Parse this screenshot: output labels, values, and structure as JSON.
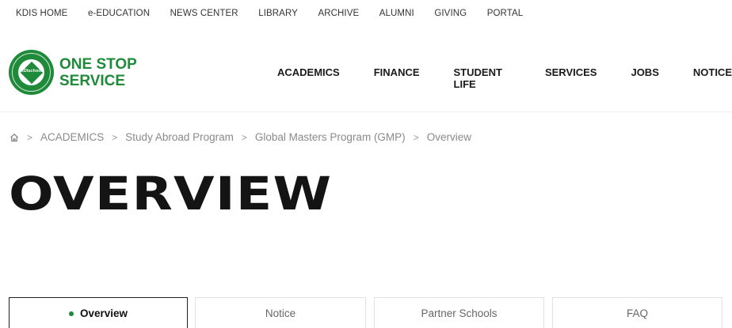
{
  "top_links": [
    "KDIS HOME",
    "e-EDUCATION",
    "NEWS CENTER",
    "LIBRARY",
    "ARCHIVE",
    "ALUMNI",
    "GIVING",
    "PORTAL"
  ],
  "logo": {
    "line1": "ONE STOP",
    "line2": "SERVICE",
    "seal_text": "KDIschool",
    "brand_color": "#1f8a3a"
  },
  "main_nav": [
    "ACADEMICS",
    "FINANCE",
    "STUDENT LIFE",
    "SERVICES",
    "JOBS",
    "NOTICE"
  ],
  "breadcrumb": [
    "ACADEMICS",
    "Study Abroad Program",
    "Global Masters Program (GMP)",
    "Overview"
  ],
  "page_title": "OVERVIEW",
  "tabs": [
    {
      "label": "Overview",
      "active": true
    },
    {
      "label": "Notice",
      "active": false
    },
    {
      "label": "Partner Schools",
      "active": false
    },
    {
      "label": "FAQ",
      "active": false
    }
  ]
}
